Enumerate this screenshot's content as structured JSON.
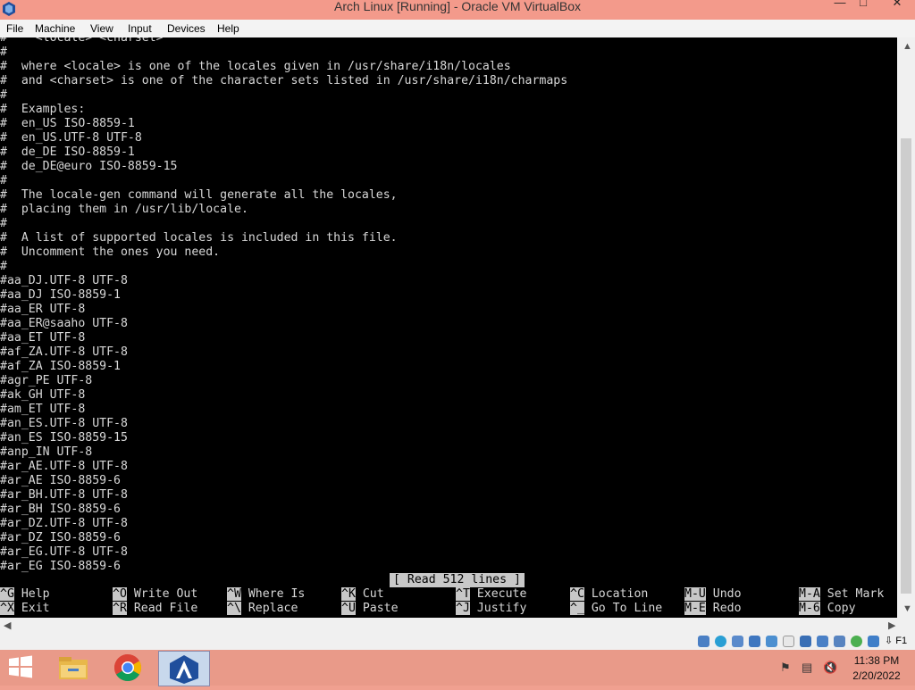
{
  "window": {
    "title": "Arch Linux [Running] - Oracle VM VirtualBox",
    "minimize_glyph": "—",
    "maximize_glyph": "□",
    "close_glyph": "✕"
  },
  "menu": {
    "items": [
      "File",
      "Machine",
      "View",
      "Input",
      "Devices",
      "Help"
    ]
  },
  "terminal": {
    "lines": [
      "#    <locale> <charset>",
      "#",
      "#  where <locale> is one of the locales given in /usr/share/i18n/locales",
      "#  and <charset> is one of the character sets listed in /usr/share/i18n/charmaps",
      "#",
      "#  Examples:",
      "#  en_US ISO-8859-1",
      "#  en_US.UTF-8 UTF-8",
      "#  de_DE ISO-8859-1",
      "#  de_DE@euro ISO-8859-15",
      "#",
      "#  The locale-gen command will generate all the locales,",
      "#  placing them in /usr/lib/locale.",
      "#",
      "#  A list of supported locales is included in this file.",
      "#  Uncomment the ones you need.",
      "#",
      "#aa_DJ.UTF-8 UTF-8",
      "#aa_DJ ISO-8859-1",
      "#aa_ER UTF-8",
      "#aa_ER@saaho UTF-8",
      "#aa_ET UTF-8",
      "#af_ZA.UTF-8 UTF-8",
      "#af_ZA ISO-8859-1",
      "#agr_PE UTF-8",
      "#ak_GH UTF-8",
      "#am_ET UTF-8",
      "#an_ES.UTF-8 UTF-8",
      "#an_ES ISO-8859-15",
      "#anp_IN UTF-8",
      "#ar_AE.UTF-8 UTF-8",
      "#ar_AE ISO-8859-6",
      "#ar_BH.UTF-8 UTF-8",
      "#ar_BH ISO-8859-6",
      "#ar_DZ.UTF-8 UTF-8",
      "#ar_DZ ISO-8859-6",
      "#ar_EG.UTF-8 UTF-8",
      "#ar_EG ISO-8859-6"
    ],
    "status_message": "[ Read 512 lines ]",
    "shortcuts": [
      {
        "key": "^G",
        "label": "Help"
      },
      {
        "key": "^O",
        "label": "Write Out"
      },
      {
        "key": "^W",
        "label": "Where Is"
      },
      {
        "key": "^K",
        "label": "Cut"
      },
      {
        "key": "^T",
        "label": "Execute"
      },
      {
        "key": "^C",
        "label": "Location"
      },
      {
        "key": "M-U",
        "label": "Undo"
      },
      {
        "key": "M-A",
        "label": "Set Mark"
      },
      {
        "key": "^X",
        "label": "Exit"
      },
      {
        "key": "^R",
        "label": "Read File"
      },
      {
        "key": "^\\",
        "label": "Replace"
      },
      {
        "key": "^U",
        "label": "Paste"
      },
      {
        "key": "^J",
        "label": "Justify"
      },
      {
        "key": "^_",
        "label": "Go To Line"
      },
      {
        "key": "M-E",
        "label": "Redo"
      },
      {
        "key": "M-6",
        "label": "Copy"
      }
    ]
  },
  "vm_status": {
    "host_key": "⇩ F1",
    "indicator_icons": [
      "harddisk-icon",
      "optical-drive-icon",
      "audio-icon",
      "network-icon",
      "usb-icon",
      "shared-folders-icon",
      "display-icon",
      "video-capture-icon",
      "cpu-icon",
      "mouse-integration-icon",
      "keyboard-icon"
    ]
  },
  "taskbar": {
    "apps": [
      "file-explorer-icon",
      "chrome-icon",
      "virtualbox-icon"
    ],
    "time": "11:38 PM",
    "date": "2/20/2022",
    "tray_icons": [
      "action-center-flag-icon",
      "network-icon",
      "volume-muted-icon"
    ]
  },
  "colors": {
    "title_bar": "#f39a8b",
    "taskbar": "#e99a89",
    "terminal_bg": "#000000",
    "terminal_fg": "#d8d8d8",
    "highlight": "#c8c8c8"
  }
}
